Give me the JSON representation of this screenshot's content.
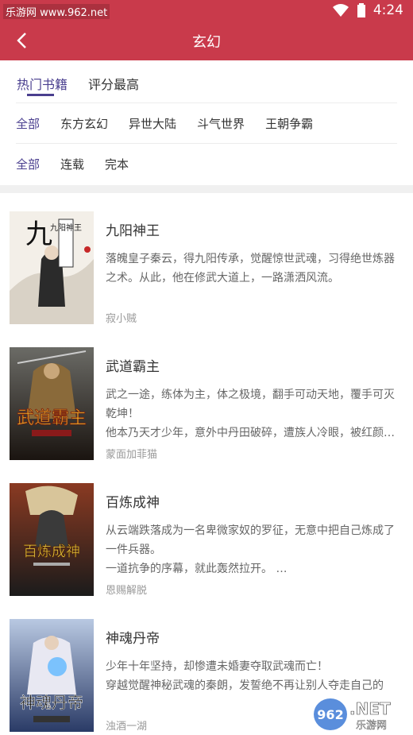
{
  "status": {
    "watermark": "乐游网 www.962.net",
    "time": "4:24"
  },
  "appbar": {
    "title": "玄幻"
  },
  "tabs": [
    {
      "label": "热门书籍"
    },
    {
      "label": "评分最高"
    }
  ],
  "categories": [
    {
      "label": "全部"
    },
    {
      "label": "东方玄幻"
    },
    {
      "label": "异世大陆"
    },
    {
      "label": "斗气世界"
    },
    {
      "label": "王朝争霸"
    }
  ],
  "status_filter": [
    {
      "label": "全部"
    },
    {
      "label": "连载"
    },
    {
      "label": "完本"
    }
  ],
  "books": [
    {
      "title": "九阳神王",
      "desc": "落魄皇子秦云，得九阳传承，觉醒惊世武魂，习得绝世炼器之术。从此，他在修武大道上，一路潇洒风流。",
      "author": "寂小贼"
    },
    {
      "title": "武道霸主",
      "desc": "武之一途，练体为主，体之极境，翻手可动天地，覆手可灭乾坤！\n他本乃天才少年，意外中丹田破碎，遭族人冷眼，被红颜…",
      "author": "蒙面加菲猫"
    },
    {
      "title": "百炼成神",
      "desc": "从云端跌落成为一名卑微家奴的罗征，无意中把自己炼成了一件兵器。\n一道抗争的序幕，就此轰然拉开。 …",
      "author": "恩赐解脱"
    },
    {
      "title": "神魂丹帝",
      "desc": "少年十年坚持，却惨遭未婚妻夺取武魂而亡！\n穿越觉醒神秘武魂的秦朗，发誓绝不再让别人夺走自己的",
      "author": "浊酒一湖"
    }
  ],
  "covers": [
    {
      "text": "九阳神王"
    },
    {
      "text": "武道霸主"
    },
    {
      "text": "百炼成神"
    },
    {
      "text": "神魂丹帝"
    }
  ],
  "watermark_bottom": {
    "logo": "962",
    "suffix": ".NET",
    "sub": "乐游网"
  },
  "colors": {
    "accent": "#c93a4b",
    "active": "#4a3f8f"
  }
}
